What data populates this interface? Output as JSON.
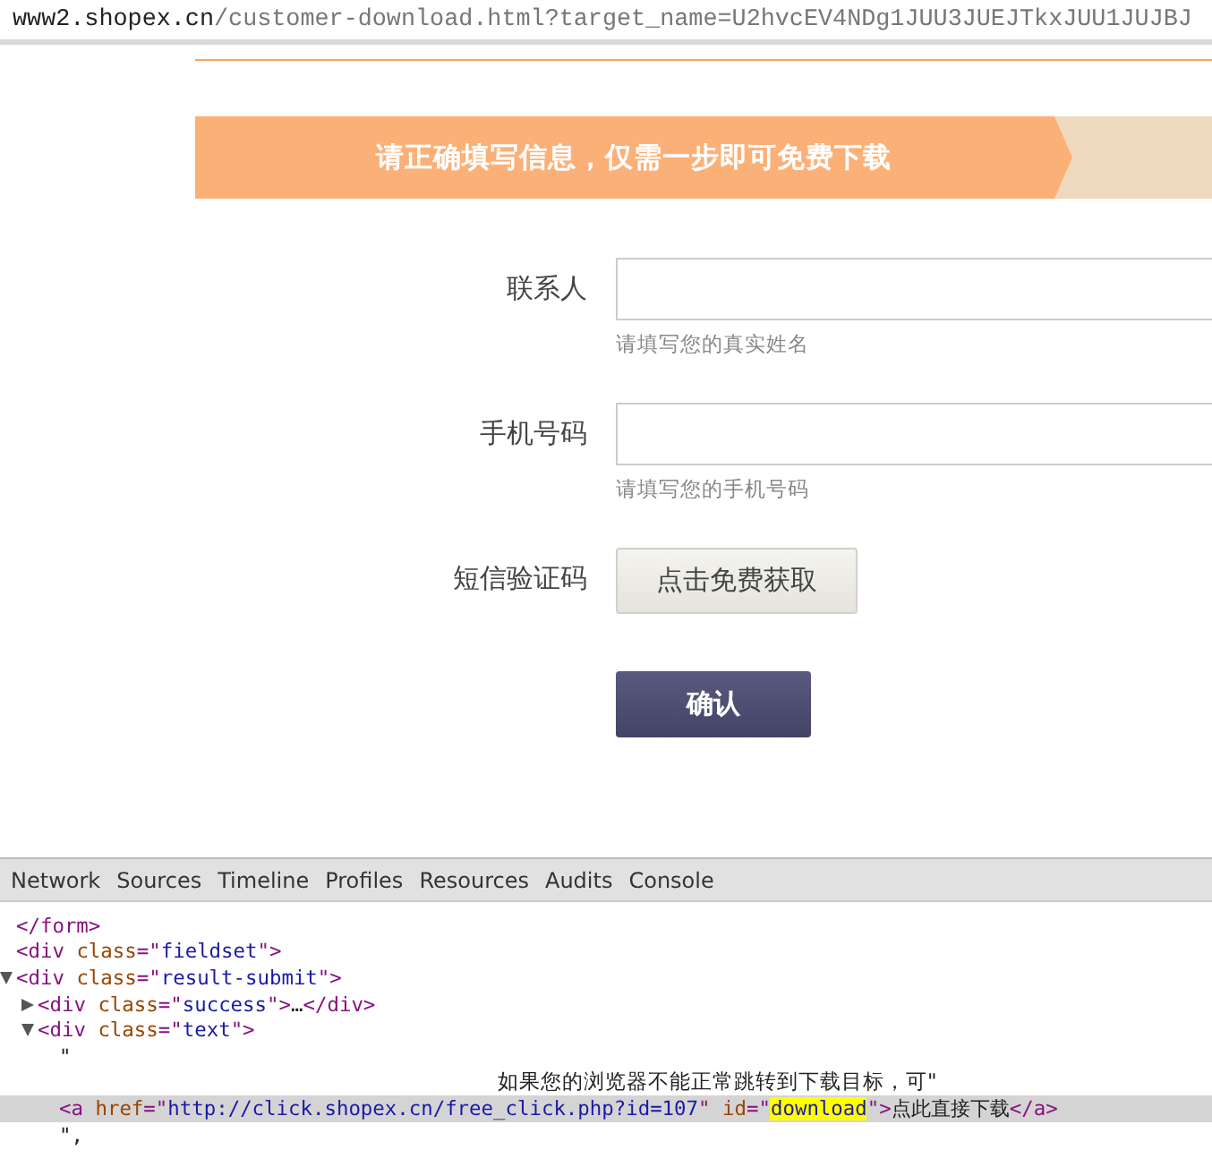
{
  "address_bar": {
    "host": "www2.shopex.cn",
    "path": "/customer-download.html?target_name=U2hvcEV4NDg1JUU3JUEJTkxJUU1JUJBJ"
  },
  "banner": {
    "text": "请正确填写信息，仅需一步即可免费下载"
  },
  "form": {
    "fields": [
      {
        "kind": "input",
        "label": "联系人",
        "hint": "请填写您的真实姓名"
      },
      {
        "kind": "input",
        "label": "手机号码",
        "hint": "请填写您的手机号码"
      },
      {
        "kind": "button",
        "label": "短信验证码",
        "button": "点击免费获取"
      }
    ],
    "submit": "确认"
  },
  "devtools": {
    "tabs": [
      {
        "label": "Network",
        "selected": false
      },
      {
        "label": "Sources",
        "selected": false
      },
      {
        "label": "Timeline",
        "selected": false
      },
      {
        "label": "Profiles",
        "selected": false
      },
      {
        "label": "Resources",
        "selected": false
      },
      {
        "label": "Audits",
        "selected": false
      },
      {
        "label": "Console",
        "selected": false
      }
    ],
    "tree": [
      {
        "selected": false,
        "segments": [
          {
            "kind": "tag",
            "text": "</form>"
          }
        ]
      },
      {
        "selected": false,
        "segments": [
          {
            "kind": "tag",
            "text": "<div "
          },
          {
            "kind": "attr",
            "text": "class"
          },
          {
            "kind": "tag",
            "text": "=\""
          },
          {
            "kind": "value",
            "text": "fieldset"
          },
          {
            "kind": "tag",
            "text": "\">"
          }
        ]
      },
      {
        "selected": false,
        "expanded": true,
        "segments": [
          {
            "kind": "tag",
            "text": "<div "
          },
          {
            "kind": "attr",
            "text": "class"
          },
          {
            "kind": "tag",
            "text": "=\""
          },
          {
            "kind": "value",
            "text": "result-submit"
          },
          {
            "kind": "tag",
            "text": "\">"
          }
        ],
        "children": [
          {
            "selected": false,
            "expanded": false,
            "segments": [
              {
                "kind": "tag",
                "text": "<div "
              },
              {
                "kind": "attr",
                "text": "class"
              },
              {
                "kind": "tag",
                "text": "=\""
              },
              {
                "kind": "value",
                "text": "success"
              },
              {
                "kind": "tag",
                "text": "\">"
              },
              {
                "kind": "text",
                "text": "…"
              },
              {
                "kind": "tag",
                "text": "</div>"
              }
            ]
          },
          {
            "selected": false,
            "expanded": true,
            "segments": [
              {
                "kind": "tag",
                "text": "<div "
              },
              {
                "kind": "attr",
                "text": "class"
              },
              {
                "kind": "tag",
                "text": "=\""
              },
              {
                "kind": "value",
                "text": "text"
              },
              {
                "kind": "tag",
                "text": "\">"
              }
            ],
            "children": [
              {
                "selected": false,
                "segments": [
                  {
                    "kind": "text",
                    "text": "\""
                  }
                ]
              },
              {
                "selected": false,
                "wrapped": true,
                "segments": [
                  {
                    "kind": "text",
                    "text": "如果您的浏览器不能正常跳转到下载目标，可\""
                  }
                ]
              },
              {
                "selected": true,
                "segments": [
                  {
                    "kind": "tag",
                    "text": "<a "
                  },
                  {
                    "kind": "attr",
                    "text": "href"
                  },
                  {
                    "kind": "tag",
                    "text": "=\""
                  },
                  {
                    "kind": "link",
                    "text": "http://click.shopex.cn/free_click.php?id=107"
                  },
                  {
                    "kind": "tag",
                    "text": "\" "
                  },
                  {
                    "kind": "attr",
                    "text": "id"
                  },
                  {
                    "kind": "tag",
                    "text": "=\""
                  },
                  {
                    "kind": "highlight",
                    "text": "download"
                  },
                  {
                    "kind": "tag",
                    "text": "\">"
                  },
                  {
                    "kind": "text",
                    "text": "点此直接下载"
                  },
                  {
                    "kind": "tag",
                    "text": "</a>"
                  }
                ]
              },
              {
                "selected": false,
                "segments": [
                  {
                    "kind": "text",
                    "text": "\","
                  }
                ]
              }
            ]
          }
        ]
      }
    ]
  }
}
